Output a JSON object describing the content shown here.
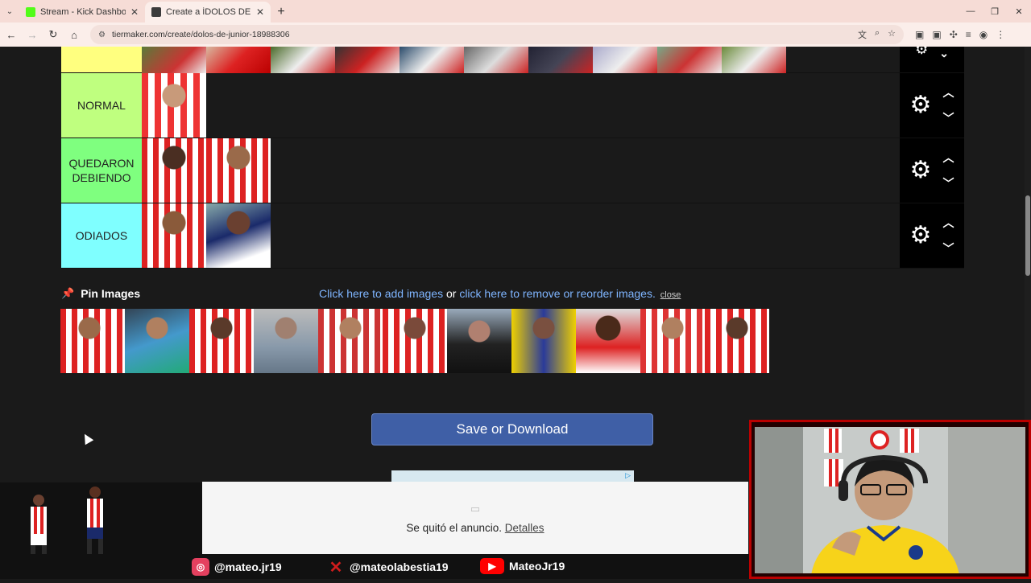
{
  "browser": {
    "tabs": [
      {
        "title": "Stream - Kick Dashboard",
        "favicon_color": "#53fc18",
        "active": false
      },
      {
        "title": "Create a ÍDOLOS DE JUNIOR Ti",
        "favicon_color": "#3b3b3b",
        "active": true
      }
    ],
    "url": "tiermaker.com/create/dolos-de-junior-18988306"
  },
  "tiers": [
    {
      "label": "",
      "color": "#ffff7f"
    },
    {
      "label": "NORMAL",
      "color": "#bfff7f"
    },
    {
      "label": "QUEDARON DEBIENDO",
      "color": "#7fff7f"
    },
    {
      "label": "ODIADOS",
      "color": "#7fffff"
    }
  ],
  "pin_bar": {
    "pin_label": "Pin Images",
    "add_link": "Click here to add images",
    "or_text": " or ",
    "remove_link": "click here to remove or reorder images.",
    "close_link": "close"
  },
  "save_button": "Save or Download",
  "ad": {
    "removed_text": "Se quitó el anuncio.",
    "details_link": "Detalles"
  },
  "socials": [
    {
      "handle": "@mateo.jr19",
      "icon": "instagram-icon",
      "color": "#e4405f"
    },
    {
      "handle": "@mateolabestia19",
      "icon": "x-icon",
      "color": "#d01c1c"
    },
    {
      "handle": "MateoJr19",
      "icon": "youtube-icon",
      "color": "#ff0000"
    }
  ]
}
